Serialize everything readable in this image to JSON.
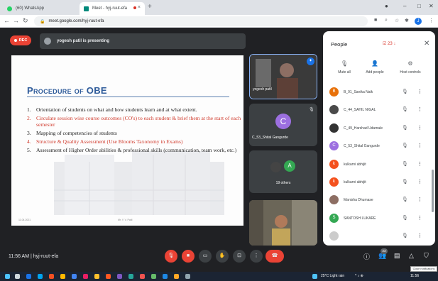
{
  "browser": {
    "tabs": [
      {
        "label": "(60) WhatsApp",
        "close": "×"
      },
      {
        "label": "Meet - hyj-ruut-efa",
        "close": "×"
      }
    ],
    "new_tab": "+",
    "window_controls": {
      "minimize": "–",
      "maximize": "□",
      "close": "✕"
    },
    "url": "meet.google.com/hyj-ruut-efa",
    "profile_initial": "J"
  },
  "meeting": {
    "recording_label": "REC",
    "presenter_text": "yogesh patil is presenting",
    "time": "11:56 AM",
    "code": "hyj-ruut-efa",
    "participant_count": "23"
  },
  "slide": {
    "title": "Procedure of OBE",
    "items": [
      {
        "num": "1.",
        "text": "Orientation of students on what and how students learn and at what extent.",
        "color": "#222222"
      },
      {
        "num": "2.",
        "text": "Circulate session wise course outcomes (CO's) to each student & brief them at the start of each semester",
        "color": "#d03a2c"
      },
      {
        "num": "3.",
        "text": "Mapping of competencies of students",
        "color": "#222222"
      },
      {
        "num": "4.",
        "text": "Structure & Quality Assessment (Use Blooms Taxonomy in Exams)",
        "color": "#d03a2c"
      },
      {
        "num": "5.",
        "text": "Assessment of Higher Order abilities & professional skills (communication, team work, etc.)",
        "color": "#222222"
      }
    ],
    "footer_left": "11.04.2021",
    "footer_right": "Mr. Y. V. Patil"
  },
  "tiles": [
    {
      "name": "yogesh patil"
    },
    {
      "name": "C_53_Shital Gangurde",
      "initial": "C",
      "color": "#9c6fe0"
    },
    {
      "name": "19 others",
      "initial": "A",
      "color": "#34a853"
    },
    {
      "name": ""
    }
  ],
  "people_panel": {
    "title": "People",
    "count_label": "23",
    "actions": [
      {
        "label": "Mute all",
        "icon": "🎙"
      },
      {
        "label": "Add people",
        "icon": "👤"
      },
      {
        "label": "Host controls",
        "icon": "⚙"
      }
    ],
    "participants": [
      {
        "initial": "B",
        "name": "B_91_Sanika Naik",
        "color": "#e8710a"
      },
      {
        "initial": "",
        "name": "C_44_SAHIL NIGAL",
        "color": "#4a4a4a"
      },
      {
        "initial": "",
        "name": "C_49_Harshad Udamale",
        "color": "#333333"
      },
      {
        "initial": "C",
        "name": "C_53_Shital Gangurde",
        "color": "#9c6fe0"
      },
      {
        "initial": "k",
        "name": "kulkarni abhijit",
        "color": "#f4511e"
      },
      {
        "initial": "k",
        "name": "kulkarni abhijit",
        "color": "#f4511e"
      },
      {
        "initial": "",
        "name": "Manisha Dhumase",
        "color": "#8d6e63"
      },
      {
        "initial": "S",
        "name": "SANTOSH LUKARE",
        "color": "#34a853"
      },
      {
        "initial": "",
        "name": "",
        "color": "#cccccc"
      }
    ]
  },
  "tooltip": "Close notifications",
  "taskbar": {
    "weather": "25°C Light rain",
    "clock": "11:56"
  },
  "colors": {
    "meet_bg": "#202124",
    "accent_red": "#ea4335",
    "slide_title": "#2e5b9a"
  }
}
